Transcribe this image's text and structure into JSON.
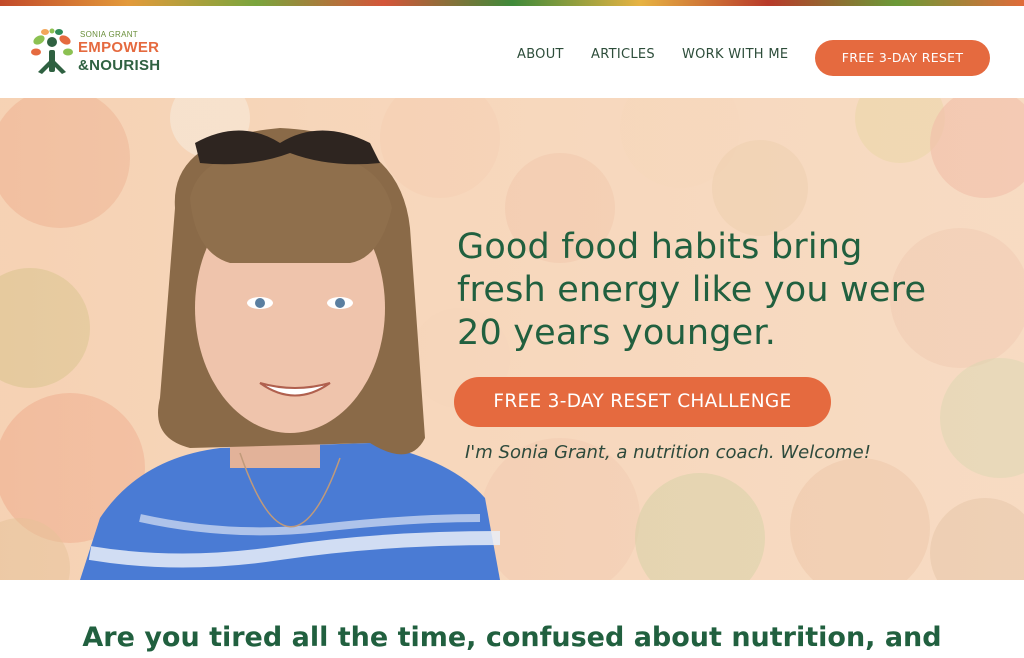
{
  "brand": {
    "owner": "SONIA GRANT",
    "line1": "EMPOWER",
    "line2": "&NOURISH"
  },
  "nav": {
    "items": [
      {
        "label": "ABOUT"
      },
      {
        "label": "ARTICLES"
      },
      {
        "label": "WORK WITH ME"
      }
    ],
    "cta_label": "FREE 3-DAY RESET"
  },
  "hero": {
    "headline": "Good food habits bring fresh energy like you were 20 years younger.",
    "cta_label": "FREE 3-DAY RESET CHALLENGE",
    "welcome": "I'm Sonia Grant, a nutrition coach. Welcome!"
  },
  "section": {
    "title": "Are you tired all the time, confused about nutrition, and"
  },
  "colors": {
    "accent": "#e56a3f",
    "brand_green": "#21603f",
    "nav_text": "#2d4d3a"
  }
}
